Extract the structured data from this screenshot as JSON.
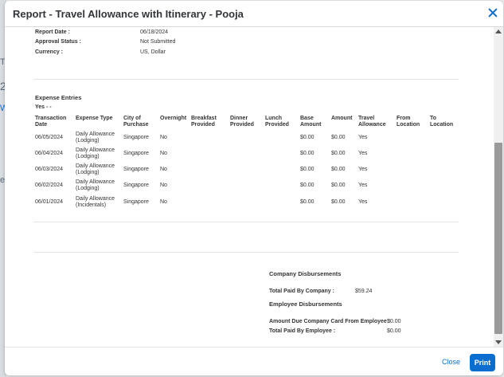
{
  "background": {
    "fragments": [
      "T.",
      "2",
      "W",
      "e"
    ]
  },
  "dialog": {
    "title": "Report - Travel Allowance with Itinerary - Pooja"
  },
  "summary": {
    "report_date_label": "Report Date :",
    "report_date_value": "06/18/2024",
    "approval_status_label": "Approval Status :",
    "approval_status_value": "Not Submitted",
    "currency_label": "Currency :",
    "currency_value": "US, Dollar"
  },
  "expense_entries": {
    "heading": "Expense Entries",
    "group_label": "Yes - -",
    "columns": {
      "transaction_date": [
        "Transaction",
        "Date"
      ],
      "expense_type": [
        "Expense Type",
        ""
      ],
      "city": [
        "City of",
        "Purchase"
      ],
      "overnight": [
        "Overnight",
        ""
      ],
      "breakfast": [
        "Breakfast",
        "Provided"
      ],
      "dinner": [
        "Dinner",
        "Provided"
      ],
      "lunch": [
        "Lunch",
        "Provided"
      ],
      "base_amount": [
        "Base",
        "Amount"
      ],
      "amount": [
        "Amount",
        ""
      ],
      "travel_allowance": [
        "Travel",
        "Allowance"
      ],
      "from_location": [
        "From",
        "Location"
      ],
      "to_location": [
        "To",
        "Location"
      ]
    },
    "rows": [
      {
        "date": "06/05/2024",
        "type1": "Daily Allowance",
        "type2": "(Lodging)",
        "city": "Singapore",
        "overnight": "No",
        "base": "$0.00",
        "amount": "$0.00",
        "ta": "Yes"
      },
      {
        "date": "06/04/2024",
        "type1": "Daily Allowance",
        "type2": "(Lodging)",
        "city": "Singapore",
        "overnight": "No",
        "base": "$0.00",
        "amount": "$0.00",
        "ta": "Yes"
      },
      {
        "date": "06/03/2024",
        "type1": "Daily Allowance",
        "type2": "(Lodging)",
        "city": "Singapore",
        "overnight": "No",
        "base": "$0.00",
        "amount": "$0.00",
        "ta": "Yes"
      },
      {
        "date": "06/02/2024",
        "type1": "Daily Allowance",
        "type2": "(Lodging)",
        "city": "Singapore",
        "overnight": "No",
        "base": "$0.00",
        "amount": "$0.00",
        "ta": "Yes"
      },
      {
        "date": "06/01/2024",
        "type1": "Daily Allowance",
        "type2": "(Incidentals)",
        "city": "Singapore",
        "overnight": "No",
        "base": "$0.00",
        "amount": "$0.00",
        "ta": "Yes"
      }
    ]
  },
  "disbursements": {
    "company_heading": "Company Disbursements",
    "total_paid_by_company_label": "Total Paid By Company :",
    "total_paid_by_company_value": "$59.24",
    "employee_heading": "Employee Disbursements",
    "amount_due_label": "Amount Due Company Card From Employee :",
    "amount_due_value": "$0.00",
    "total_paid_by_employee_label": "Total Paid By Employee :",
    "total_paid_by_employee_value": "$0.00"
  },
  "footer": {
    "close_label": "Close",
    "print_label": "Print"
  },
  "colors": {
    "accent": "#0a6ed1"
  }
}
